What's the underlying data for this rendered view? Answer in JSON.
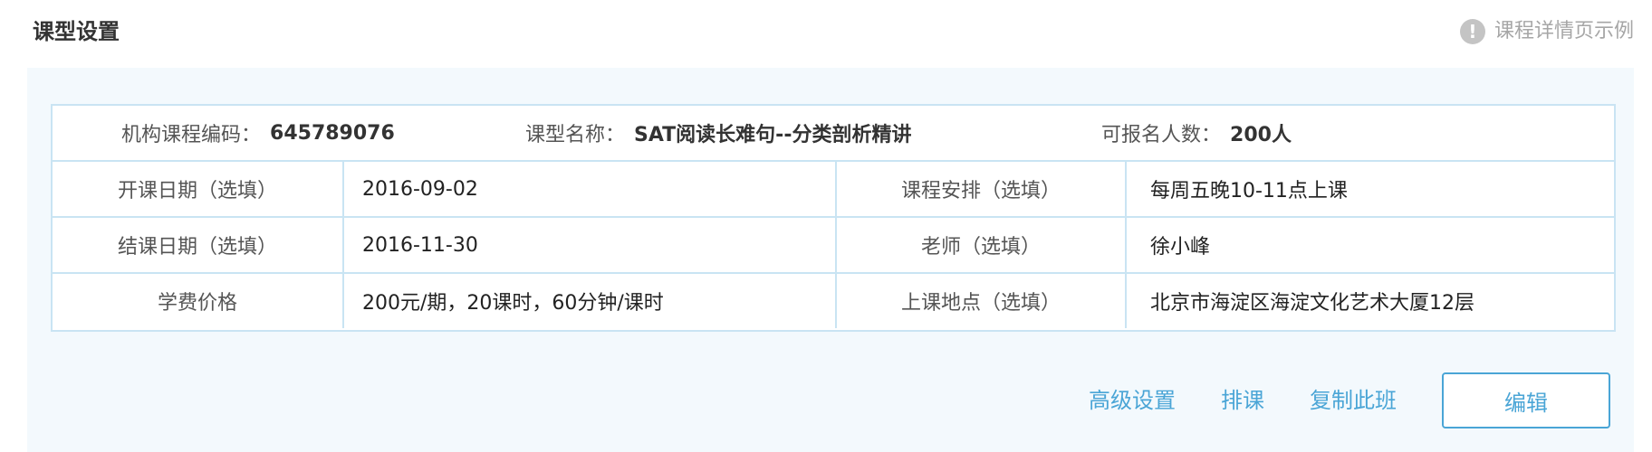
{
  "header": {
    "title": "课型设置",
    "example_link": "课程详情页示例",
    "info_icon_glyph": "!"
  },
  "summary": {
    "code_label": "机构课程编码：",
    "code_value": "645789076",
    "name_label": "课型名称：",
    "name_value": "SAT阅读长难句--分类剖析精讲",
    "capacity_label": "可报名人数：",
    "capacity_value": "200人"
  },
  "rows": [
    {
      "left_label": "开课日期（选填）",
      "left_value": "2016-09-02",
      "right_label": "课程安排（选填）",
      "right_value": "每周五晚10-11点上课"
    },
    {
      "left_label": "结课日期（选填）",
      "left_value": "2016-11-30",
      "right_label": "老师（选填）",
      "right_value": "徐小峰"
    },
    {
      "left_label": "学费价格",
      "left_value": "200元/期，20课时，60分钟/课时",
      "right_label": "上课地点（选填）",
      "right_value": "北京市海淀区海淀文化艺术大厦12层"
    }
  ],
  "actions": {
    "advanced_settings": "高级设置",
    "schedule": "排课",
    "copy_class": "复制此班",
    "edit": "编辑"
  },
  "colors": {
    "accent": "#4aa5d6",
    "panel_bg": "#f3f9fd",
    "border": "#c9e4f3",
    "muted_text": "#a6a6a6"
  }
}
